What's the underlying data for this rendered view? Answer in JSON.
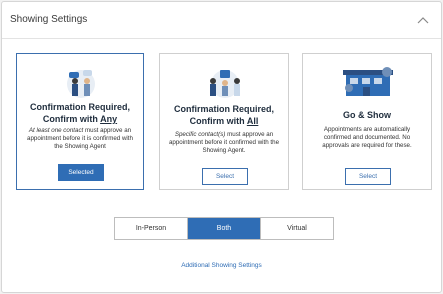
{
  "header": {
    "title": "Showing Settings"
  },
  "cards": [
    {
      "title_line1": "Confirmation Required,",
      "title_prefix": "Confirm with ",
      "title_emph": "Any",
      "desc_em": "At least one contact",
      "desc_rest": " must approve an appointment before it is confirmed with the Showing Agent",
      "button": "Selected"
    },
    {
      "title_line1": "Confirmation Required,",
      "title_prefix": "Confirm with ",
      "title_emph": "All",
      "desc_em": "Specific contact(s)",
      "desc_rest": " must approve an appointment before it confirmed with the Showing Agent.",
      "button": "Select"
    },
    {
      "title": "Go & Show",
      "desc": "Appointments are automatically confirmed and documented.  No approvals are required for these.",
      "button": "Select"
    }
  ],
  "segmented": {
    "options": [
      "In-Person",
      "Both",
      "Virtual"
    ],
    "selected": "Both"
  },
  "link": "Additional Showing Settings",
  "colors": {
    "accent": "#2f6db5",
    "border_selected": "#3b6fae"
  }
}
